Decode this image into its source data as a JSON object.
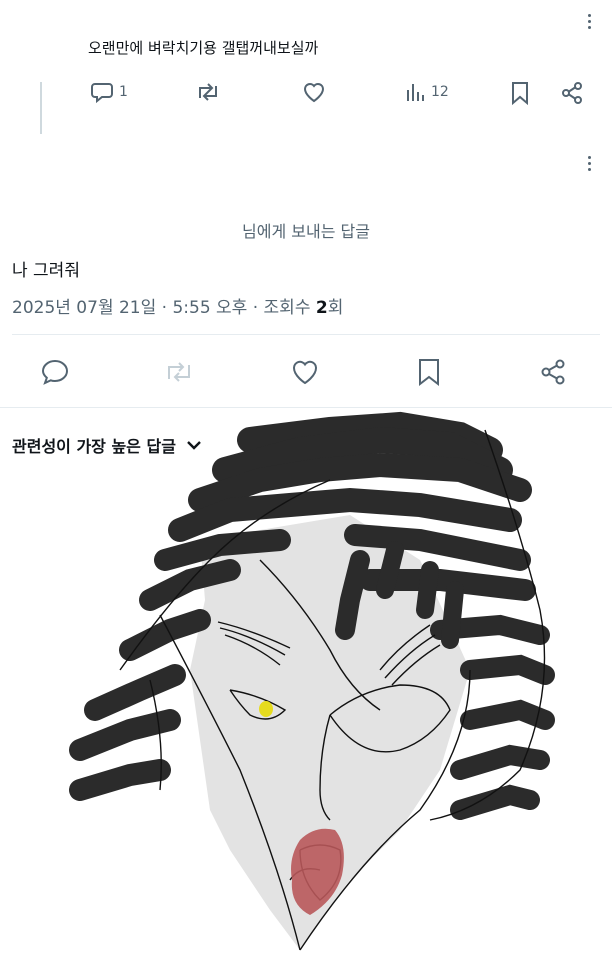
{
  "reply_tweet": {
    "text": "오랜만에 벼락치기용 갤탭꺼내보실까",
    "reply_count": "1",
    "view_count": "12"
  },
  "main_tweet": {
    "destination": "님에게 보내는 답글",
    "text": "나 그려줘",
    "timestamp": "2025년 07월 21일 · 5:55 오후 · 조회수",
    "view_count": "2",
    "view_unit": "회"
  },
  "replies_section": {
    "sort_label": "관련성이 가장 높은 답글"
  },
  "colors": {
    "text_primary": "#0f1419",
    "text_secondary": "#536471",
    "divider": "#e6ecf0",
    "hair": "#2b2b2b",
    "skin_fill": "#e3e3e3",
    "lips": "#b8585a",
    "eye": "#e6dc1e"
  }
}
